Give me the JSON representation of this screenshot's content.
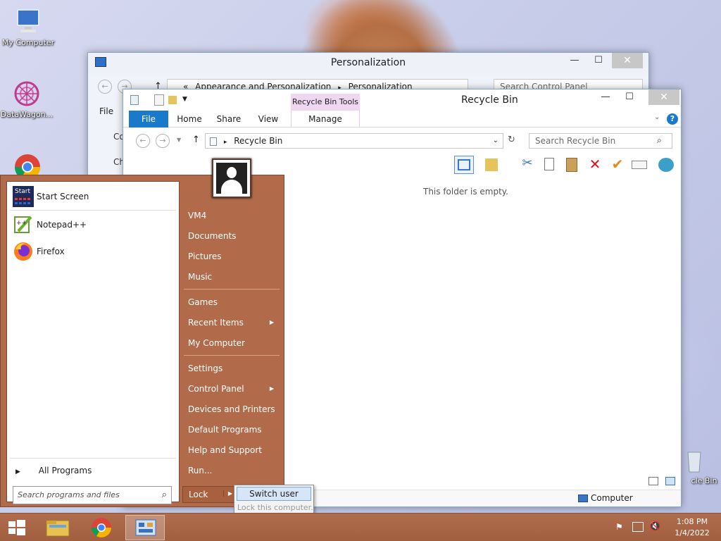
{
  "desktop": {
    "icons": [
      {
        "label": "My Computer",
        "icon": "computer-icon"
      },
      {
        "label": "DataWagon...",
        "icon": "datawagon-icon"
      },
      {
        "label": "cle Bin",
        "icon": "recycle-bin-icon"
      }
    ]
  },
  "personalization": {
    "title": "Personalization",
    "address_prefix": "«",
    "address_1": "Appearance and Personalization",
    "address_sep": "▸",
    "address_2": "Personalization",
    "search_placeholder": "Search Control Panel",
    "file_tab": "File",
    "side_1": "Co",
    "side_2": "Ch"
  },
  "recycle": {
    "title": "Recycle Bin",
    "context_tab": "Recycle Bin Tools",
    "tabs": [
      "File",
      "Home",
      "Share",
      "View",
      "Manage"
    ],
    "address": "Recycle Bin",
    "search_placeholder": "Search Recycle Bin",
    "empty_msg": "This folder is empty.",
    "status_location": "Computer",
    "help": "?"
  },
  "startmenu": {
    "programs": [
      {
        "label": "Start Screen",
        "icon": "start-screen-icon"
      },
      {
        "label": "Notepad++",
        "icon": "notepadpp-icon"
      },
      {
        "label": "Firefox",
        "icon": "firefox-icon"
      }
    ],
    "start_icon_text": "Start",
    "all_programs": "All Programs",
    "search_placeholder": "Search programs and files",
    "right_items": [
      "VM4",
      "Documents",
      "Pictures",
      "Music",
      "Games",
      "Recent Items",
      "My Computer",
      "Settings",
      "Control Panel",
      "Devices and Printers",
      "Default Programs",
      "Help and Support",
      "Run..."
    ],
    "lock": "Lock",
    "switch_user": "Switch user",
    "lock_tooltip": "Lock this computer."
  },
  "taskbar": {
    "time": "1:08 PM",
    "date": "1/4/2022"
  }
}
